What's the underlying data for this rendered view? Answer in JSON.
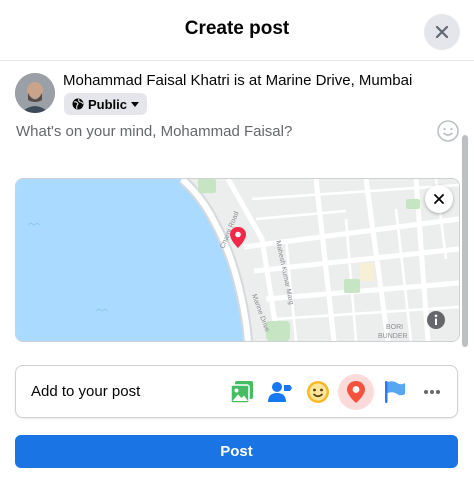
{
  "header": {
    "title": "Create post"
  },
  "author": {
    "text": "Mohammad Faisal Khatri is at Marine Drive, Mumbai",
    "privacy_label": "Public"
  },
  "composer": {
    "placeholder": "What's on your mind, Mohammad Faisal?"
  },
  "map": {
    "labels": [
      "Charni Road",
      "Marine Drive",
      "Mahesh Kumar Marg",
      "BORI",
      "BUNDER"
    ],
    "pin_color": "#f02849"
  },
  "add_to_post": {
    "label": "Add to your post",
    "options": [
      "photo-video-icon",
      "tag-people-icon",
      "feeling-icon",
      "check-in-icon",
      "flag-icon",
      "more-icon"
    ]
  },
  "post_button": {
    "label": "Post"
  },
  "colors": {
    "accent": "#1b74e4",
    "map_water": "#aadaff"
  }
}
